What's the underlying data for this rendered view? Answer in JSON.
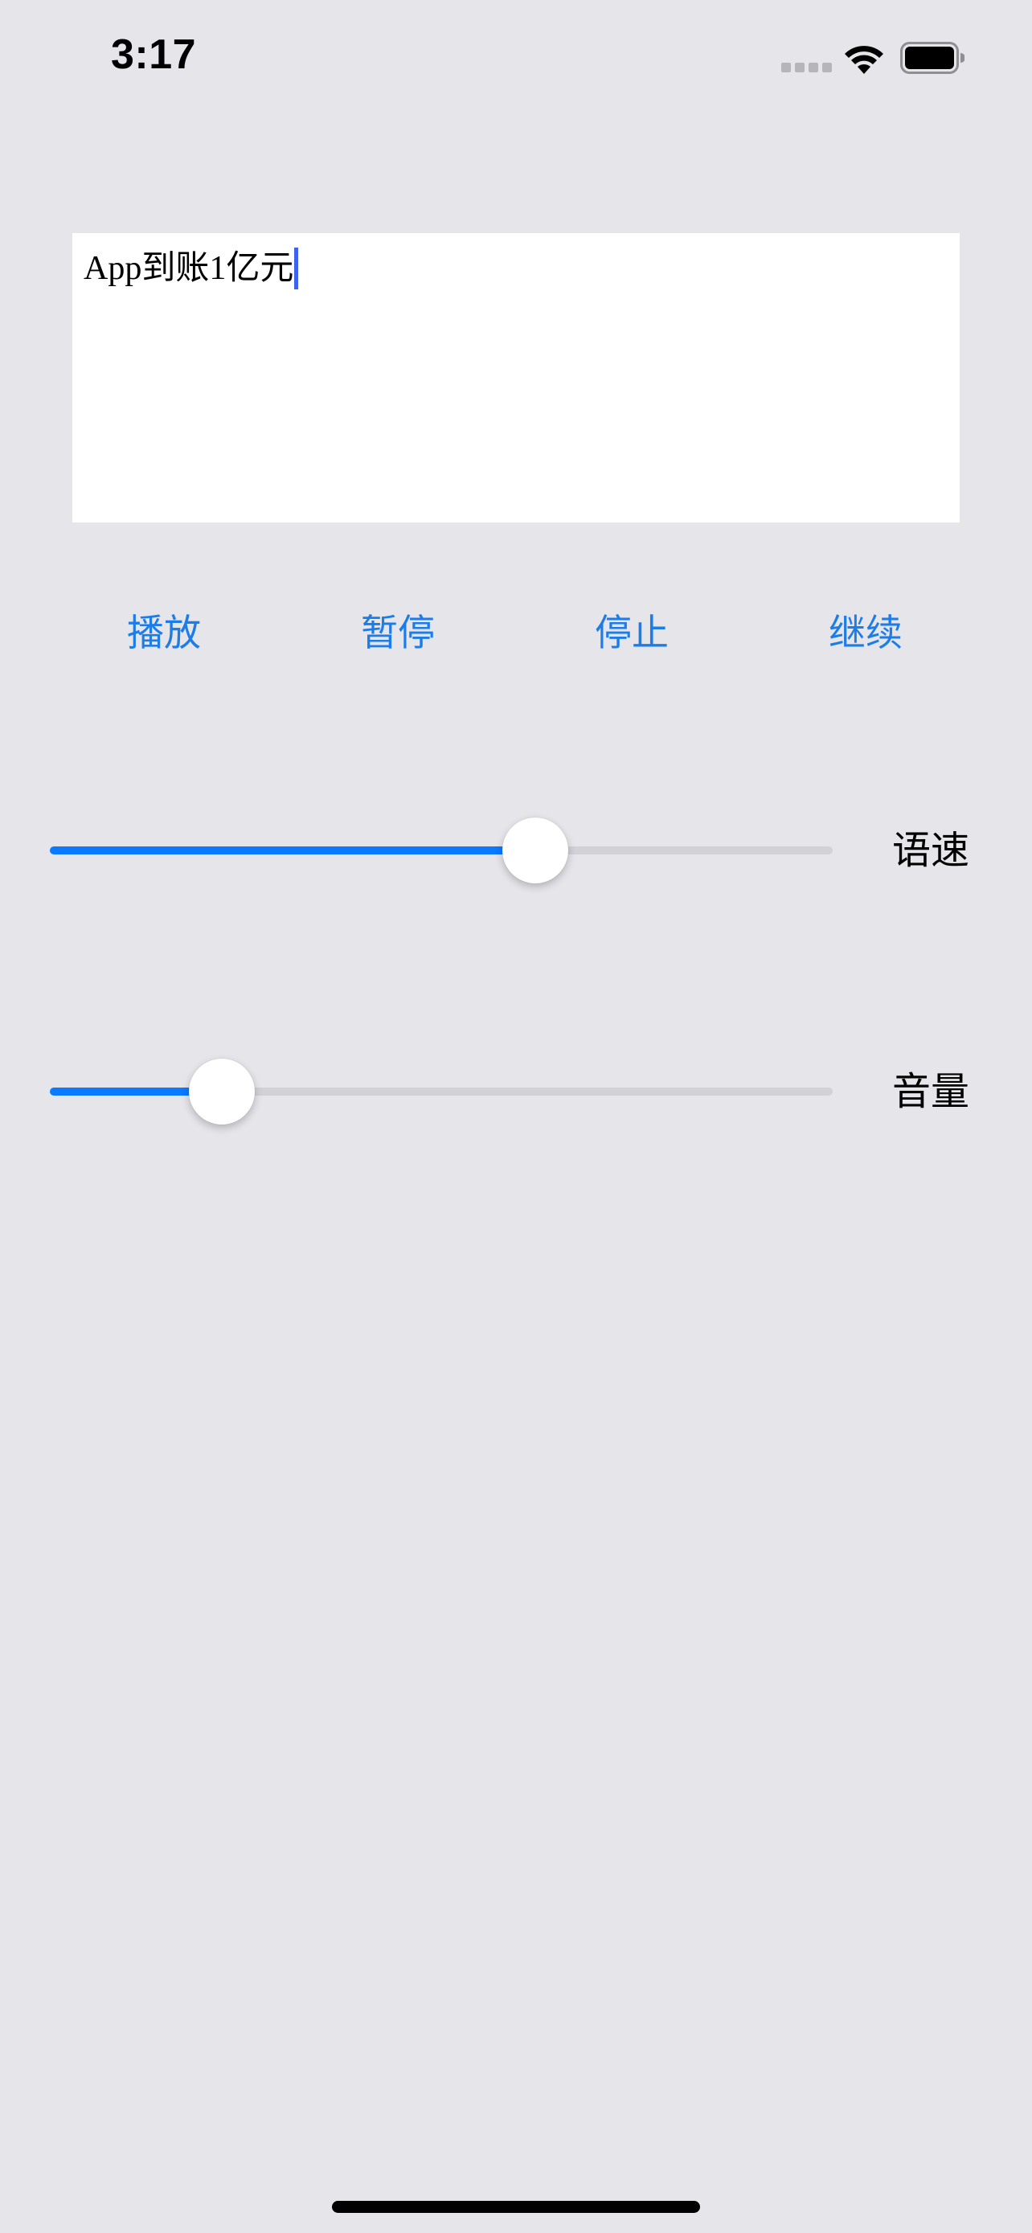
{
  "status_bar": {
    "time": "3:17",
    "icons": [
      "signal-dots-icon",
      "wifi-icon",
      "battery-icon"
    ]
  },
  "text_view": {
    "value": "App到账1亿元"
  },
  "buttons": {
    "play": "播放",
    "pause": "暂停",
    "stop": "停止",
    "resume": "继续"
  },
  "sliders": {
    "speed": {
      "label": "语速",
      "value": 0.62
    },
    "volume": {
      "label": "音量",
      "value": 0.22
    }
  },
  "colors": {
    "accent": "#0a7aff",
    "button_text": "#1c7ce8",
    "background": "#e5e5ea",
    "track": "#d1d1d6",
    "caret": "#3b63f0"
  }
}
